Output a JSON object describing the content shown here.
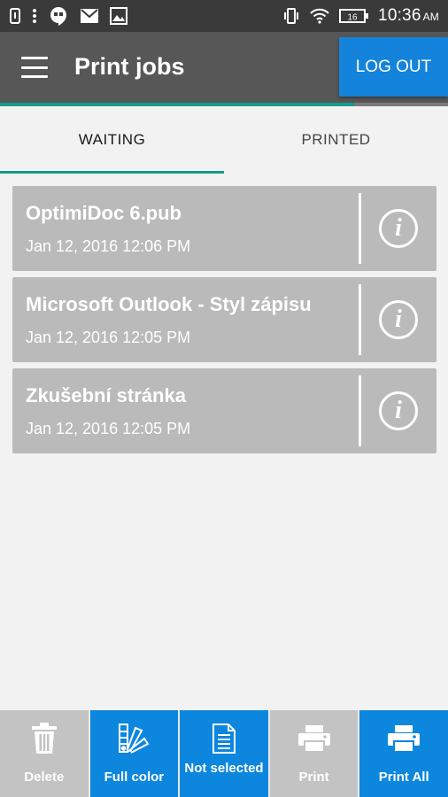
{
  "status_bar": {
    "time": "10:36",
    "ampm": "AM",
    "battery_level": "16"
  },
  "app_bar": {
    "title": "Print jobs",
    "logout_label": "LOG OUT",
    "progress_fraction": 0.79
  },
  "tabs": [
    {
      "label": "WAITING",
      "active": true
    },
    {
      "label": "PRINTED",
      "active": false
    }
  ],
  "jobs": [
    {
      "name": "OptimiDoc 6.pub",
      "date": "Jan 12, 2016 12:06 PM"
    },
    {
      "name": "Microsoft Outlook - Styl zápisu",
      "date": "Jan 12, 2016 12:05 PM"
    },
    {
      "name": "Zkušební stránka",
      "date": "Jan 12, 2016 12:05 PM"
    }
  ],
  "bottom_bar": [
    {
      "label": "Delete",
      "icon": "trash-icon",
      "state": "disabled"
    },
    {
      "label": "Full color",
      "icon": "color-palette-icon",
      "state": "active"
    },
    {
      "label": "Not selected",
      "icon": "document-icon",
      "state": "active"
    },
    {
      "label": "Print",
      "icon": "printer-icon",
      "state": "disabled"
    },
    {
      "label": "Print All",
      "icon": "printer-icon",
      "state": "active"
    }
  ],
  "colors": {
    "accent_blue": "#0d86de",
    "accent_teal": "#159b8b",
    "app_bar": "#575757",
    "status_bar": "#3a3a3a",
    "job_card": "#bababa"
  }
}
